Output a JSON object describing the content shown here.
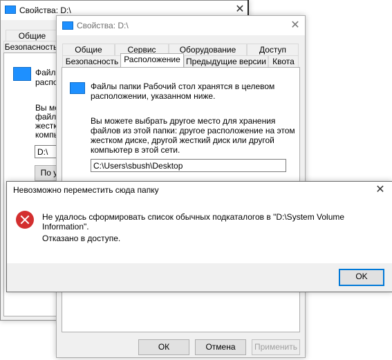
{
  "back_window": {
    "title": "Свойства: D:\\",
    "tabs": [
      "Общие",
      "Безопасность"
    ],
    "desc_line1": "Файлы",
    "desc_line2": "располо",
    "text_lines": [
      "Вы мо",
      "файло",
      "жестк",
      "компь"
    ],
    "path_value": "D:\\",
    "button_partial": "По у"
  },
  "props_window": {
    "title": "Свойства: D:\\",
    "tabs_top": [
      "Общие",
      "Сервис",
      "Оборудование",
      "Доступ"
    ],
    "tabs_bottom": [
      "Безопасность",
      "Расположение",
      "Предыдущие версии",
      "Квота"
    ],
    "active_tab": "Расположение",
    "info_line1": "Файлы папки Рабочий стол хранятся в целевом",
    "info_line2": "расположении, указанном ниже.",
    "hint_lines": [
      "Вы можете выбрать другое место для хранения",
      "файлов из этой папки: другое расположение на этом",
      "жестком диске, другой жесткий диск или другой",
      "компьютер в этой сети."
    ],
    "path_value": "C:\\Users\\sbush\\Desktop",
    "ok_label": "ОК",
    "cancel_label": "Отмена",
    "apply_label": "Применить"
  },
  "error_dialog": {
    "title": "Невозможно переместить сюда папку",
    "message_line1": "Не удалось сформировать список обычных подкаталогов в \"D:\\System Volume",
    "message_line2": "Information\".",
    "message_line3": "Отказано в доступе.",
    "ok_label": "OK"
  },
  "colors": {
    "accent": "#0078d7",
    "error": "#d32f2f",
    "folder": "#1e90ff"
  }
}
